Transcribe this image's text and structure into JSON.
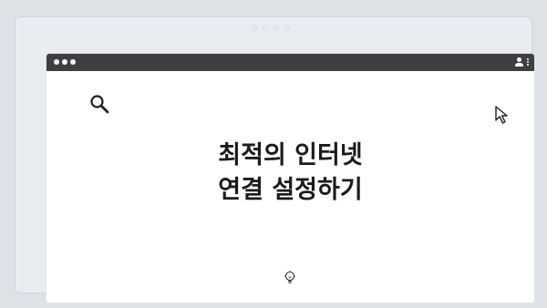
{
  "window": {
    "title_bar_color": "#3f3f41",
    "dots_color": "#ffffff"
  },
  "icons": {
    "search": "search-icon",
    "cursor": "cursor-arrow-icon",
    "user": "user-icon",
    "menu": "kebab-menu-icon",
    "bulb": "lightbulb-icon"
  },
  "main": {
    "headline_line1": "최적의 인터넷",
    "headline_line2": "연결 설정하기"
  }
}
